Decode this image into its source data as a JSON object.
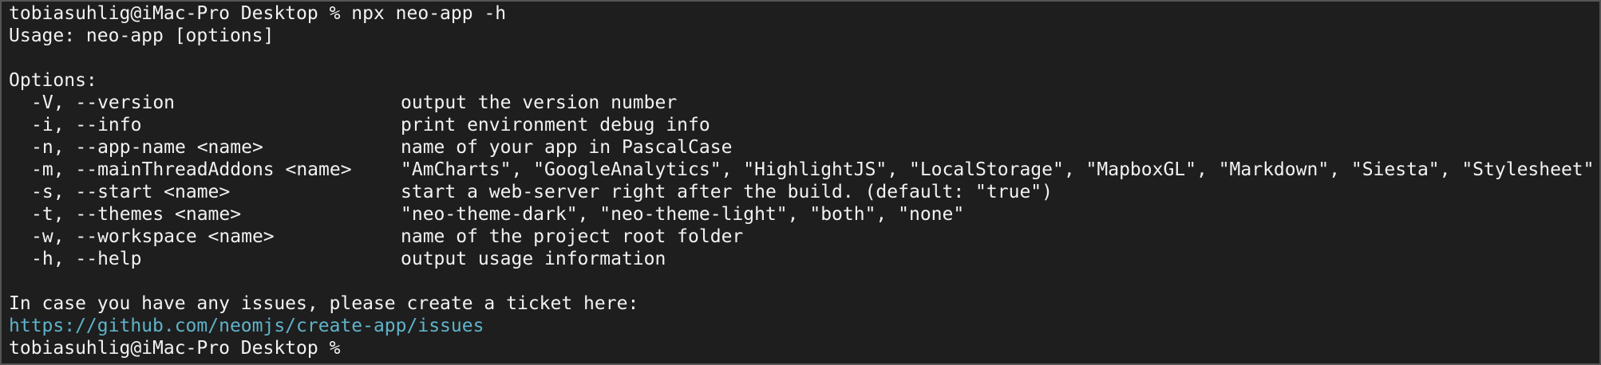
{
  "terminal": {
    "prompt": "tobiasuhlig@iMac-Pro Desktop %",
    "command": "npx neo-app -h",
    "usage": "Usage: neo-app [options]",
    "options_heading": "Options:",
    "options": [
      {
        "flag": "-V, --version",
        "description": "output the version number"
      },
      {
        "flag": "-i, --info",
        "description": "print environment debug info"
      },
      {
        "flag": "-n, --app-name <name>",
        "description": "name of your app in PascalCase"
      },
      {
        "flag": "-m, --mainThreadAddons <name>",
        "description": "\"AmCharts\", \"GoogleAnalytics\", \"HighlightJS\", \"LocalStorage\", \"MapboxGL\", \"Markdown\", \"Siesta\", \"Stylesheet\""
      },
      {
        "flag": "-s, --start <name>",
        "description": "start a web-server right after the build. (default: \"true\")"
      },
      {
        "flag": "-t, --themes <name>",
        "description": "\"neo-theme-dark\", \"neo-theme-light\", \"both\", \"none\""
      },
      {
        "flag": "-w, --workspace <name>",
        "description": "name of the project root folder"
      },
      {
        "flag": "-h, --help",
        "description": "output usage information"
      }
    ],
    "issues_text": "In case you have any issues, please create a ticket here:",
    "issues_link": "https://github.com/neomjs/create-app/issues",
    "final_prompt": "tobiasuhlig@iMac-Pro Desktop %"
  },
  "colors": {
    "background": "#1e1e1e",
    "text": "#f2f2f2",
    "link": "#5fb3c9",
    "border": "#555555"
  }
}
